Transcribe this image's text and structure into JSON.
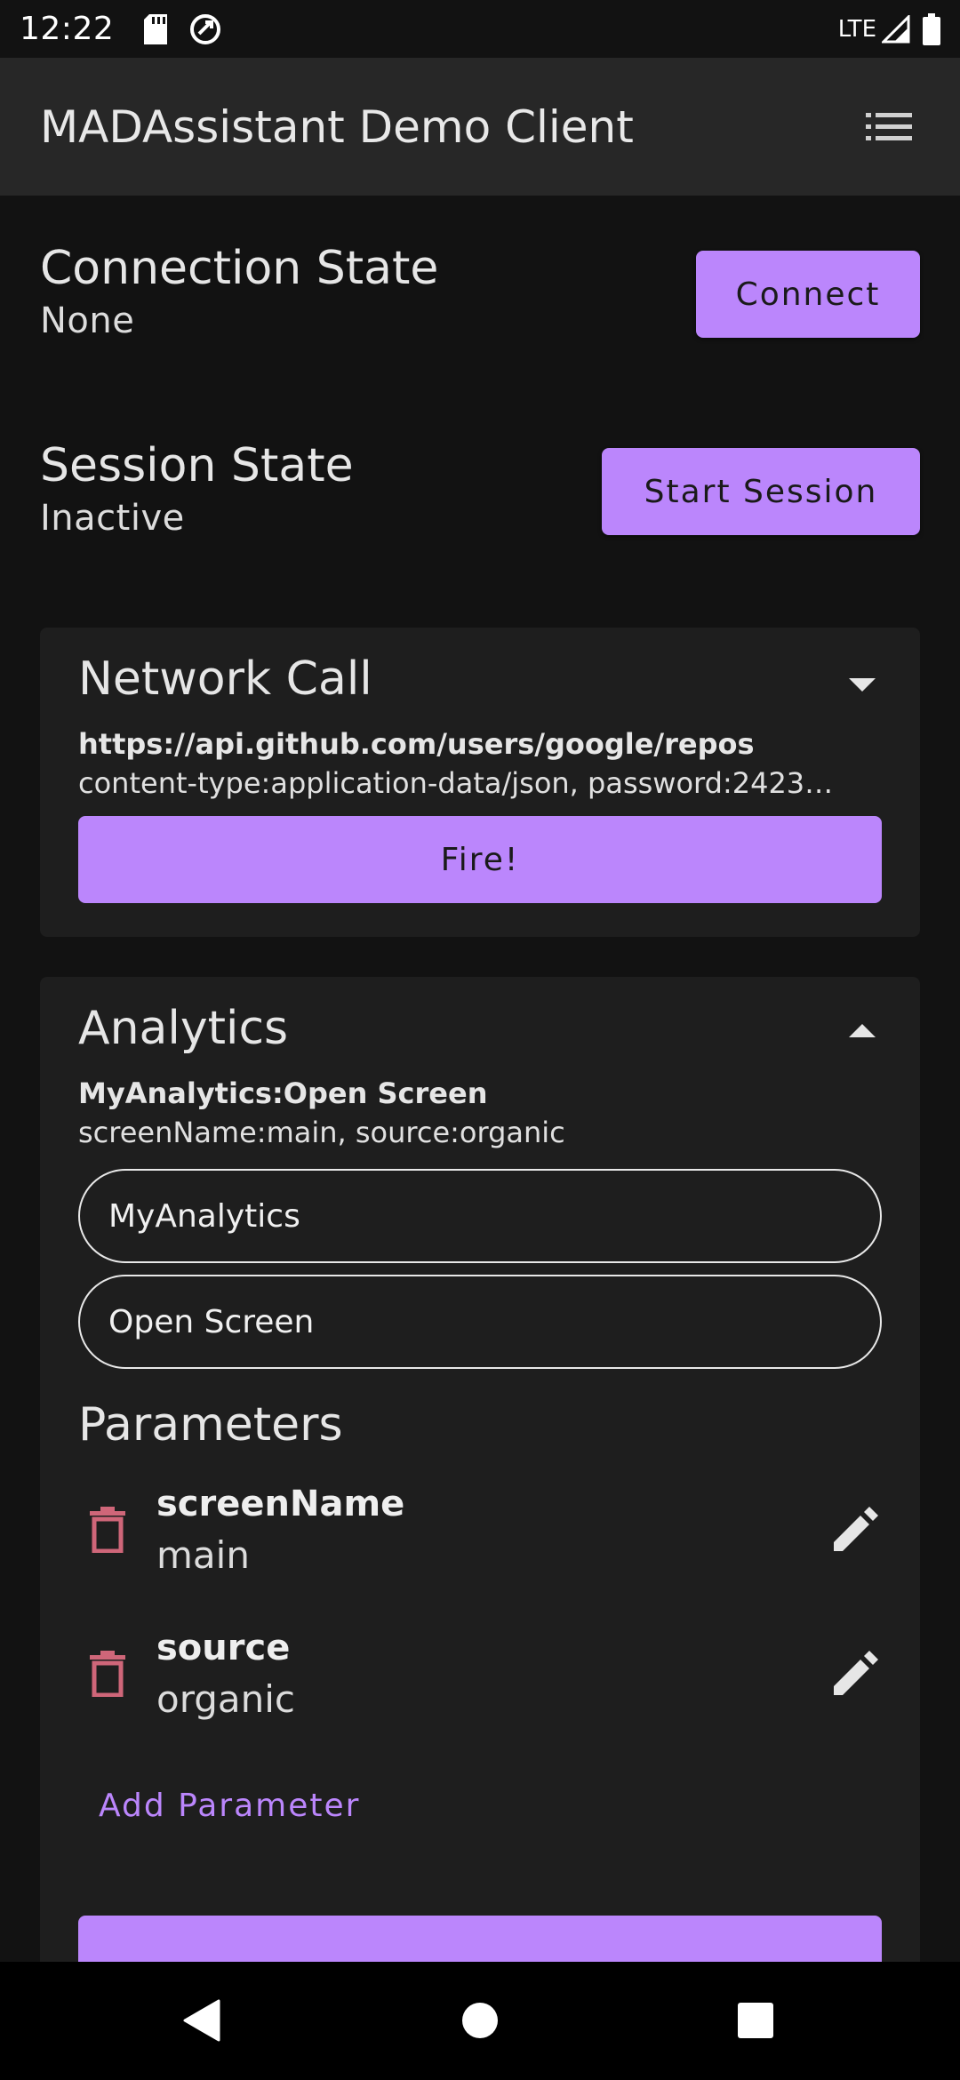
{
  "status_bar": {
    "time": "12:22",
    "network": "LTE"
  },
  "app_bar": {
    "title": "MADAssistant Demo Client"
  },
  "connection": {
    "label": "Connection State",
    "value": "None",
    "button_label": "Connect"
  },
  "session": {
    "label": "Session State",
    "value": "Inactive",
    "button_label": "Start Session"
  },
  "network_call": {
    "title": "Network Call",
    "url": "https://api.github.com/users/google/repos",
    "headers": "content-type:application-data/json, password:2423…",
    "button_label": "Fire!"
  },
  "analytics": {
    "title": "Analytics",
    "summary": "MyAnalytics:Open Screen",
    "params_summary": "screenName:main, source:organic",
    "destination_value": "MyAnalytics",
    "event_value": "Open Screen",
    "parameters_heading": "Parameters",
    "parameters": [
      {
        "name": "screenName",
        "value": "main"
      },
      {
        "name": "source",
        "value": "organic"
      }
    ],
    "add_parameter_label": "Add Parameter"
  },
  "colors": {
    "accent": "#bb86fc",
    "delete": "#cf6679",
    "background": "#121212",
    "card": "#1e1e1e",
    "app_bar": "#272727"
  }
}
